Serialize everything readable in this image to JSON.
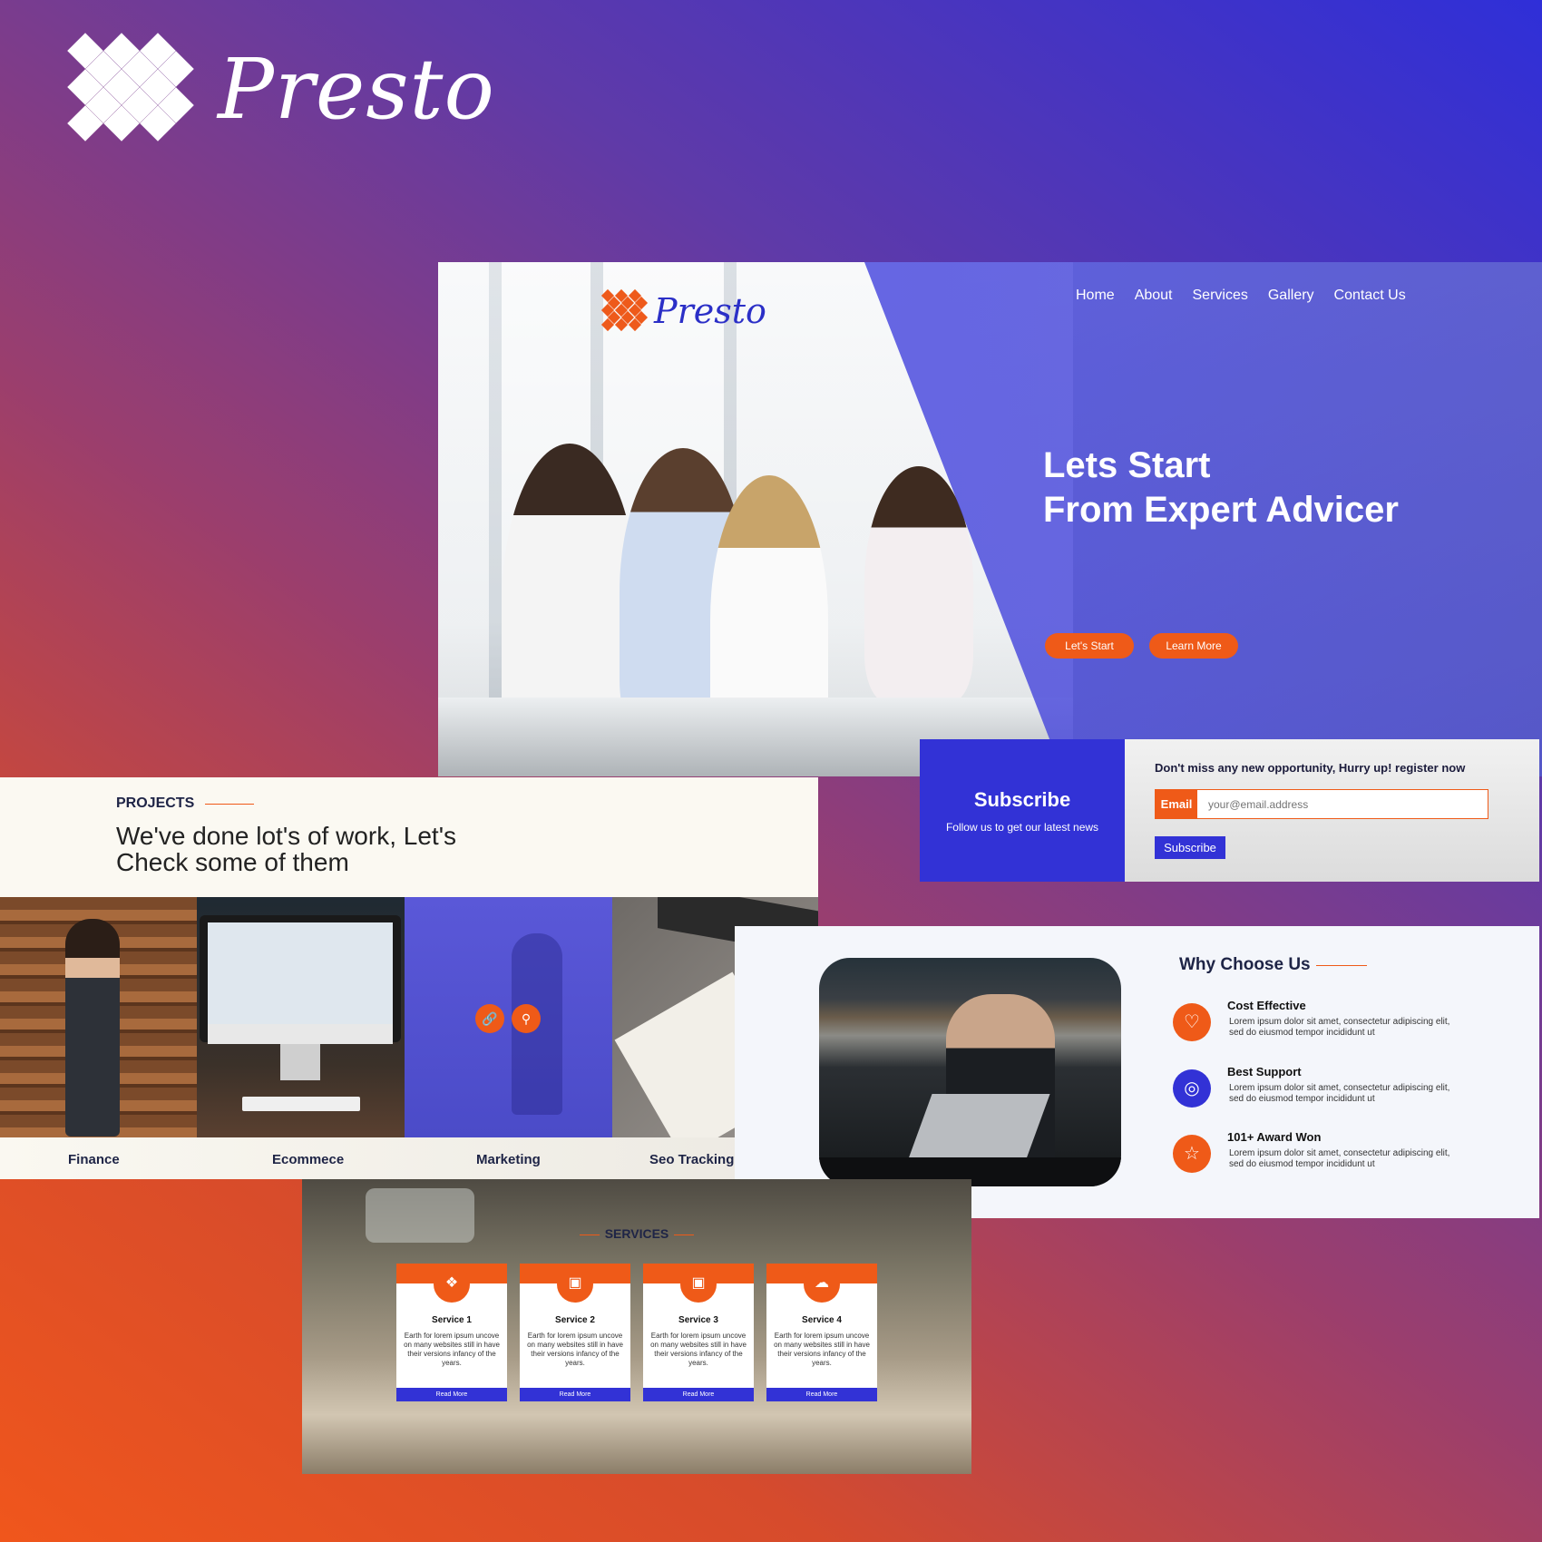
{
  "brand": {
    "name": "Presto"
  },
  "hero": {
    "logo_text": "Presto",
    "nav": [
      "Home",
      "About",
      "Services",
      "Gallery",
      "Contact Us"
    ],
    "title_line1": "Lets Start",
    "title_line2": "From Expert Advicer",
    "btn_start": "Let's Start",
    "btn_learn": "Learn More"
  },
  "subscribe": {
    "title": "Subscribe",
    "subtitle": "Follow us to get our latest news",
    "message": "Don't miss any new opportunity, Hurry up! register now",
    "email_label": "Email",
    "email_placeholder": "your@email.address",
    "button": "Subscribe"
  },
  "projects": {
    "heading": "PROJECTS",
    "title_line1": "We've done lot's  of work, Let's",
    "title_line2": "Check some of them",
    "items": [
      "Finance",
      "Ecommece",
      "Marketing",
      "Seo Tracking A"
    ]
  },
  "why": {
    "title": "Why Choose Us",
    "features": [
      {
        "title": "Cost Effective",
        "text": "Lorem ipsum dolor sit amet, consectetur adipiscing elit, sed do eiusmod tempor incididunt ut"
      },
      {
        "title": "Best Support",
        "text": "Lorem ipsum dolor sit amet, consectetur adipiscing elit, sed do eiusmod tempor incididunt ut"
      },
      {
        "title": "101+  Award Won",
        "text": "Lorem ipsum dolor sit amet, consectetur adipiscing elit, sed do eiusmod tempor incididunt ut"
      }
    ]
  },
  "services": {
    "heading": "SERVICES",
    "cards": [
      {
        "title": "Service 1",
        "text": "Earth for lorem ipsum uncove on many websites still in have their versions infancy of the years.",
        "button": "Read More"
      },
      {
        "title": "Service 2",
        "text": "Earth for lorem ipsum uncove on many websites still in have their versions infancy of the years.",
        "button": "Read More"
      },
      {
        "title": "Service 3",
        "text": "Earth for lorem ipsum uncove on many websites still in have their versions infancy of the years.",
        "button": "Read More"
      },
      {
        "title": "Service 4",
        "text": "Earth for lorem ipsum uncove on many websites still in have their versions infancy of the years.",
        "button": "Read More"
      }
    ]
  },
  "colors": {
    "accent": "#ef5a18",
    "primary": "#3232d6",
    "dark_text": "#1e2446"
  }
}
